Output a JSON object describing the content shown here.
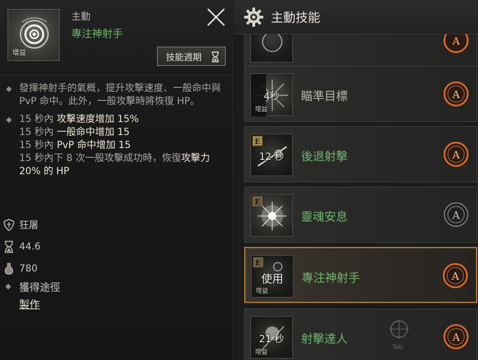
{
  "tooltip": {
    "skill_type": "主動",
    "skill_name": "專注神射手",
    "icon_tag": "增益",
    "cycle_button_label": "技能週期",
    "description": "發揮神射手的氣概，提升攻擊速度、一般命中與 PvP 命中。此外，一般攻擊時將恢復 HP。",
    "effects": {
      "line1_prefix": "15 秒內 ",
      "line1_hl": "攻擊速度增加 15%",
      "line2_prefix": "15 秒內 ",
      "line2_hl": "一般命中增加 15",
      "line3_prefix": "15 秒內 ",
      "line3_hl": " PvP 命中增加 15",
      "line4_prefix": "15 秒內下 8 次一般攻擊成功時，恢復",
      "line4_hl": "攻擊力 20% 的 HP"
    },
    "stats": [
      {
        "icon": "shield-icon",
        "value": "狂屠"
      },
      {
        "icon": "hourglass-icon",
        "value": "44.6"
      },
      {
        "icon": "potion-icon",
        "value": "780"
      }
    ],
    "acquire_title": "獲得途徑",
    "acquire_link": "製作"
  },
  "skill_list": {
    "title": "主動技能",
    "items": [
      {
        "name": "瞄準目標",
        "cooldown": "4秒",
        "tag": "增益",
        "badge": "",
        "auto": "A"
      },
      {
        "name": "後退射擊",
        "cooldown": "12 秒",
        "tag": "",
        "badge": "E",
        "auto": "A"
      },
      {
        "name": "靈魂安息",
        "cooldown": "",
        "tag": "",
        "badge": "E",
        "auto": "A"
      },
      {
        "name": "專注神射手",
        "use_label": "使用",
        "tag": "增益",
        "badge": "E",
        "auto": "A"
      },
      {
        "name": "射擊達人",
        "cooldown": "21 秒",
        "tag": "增益",
        "badge": "",
        "auto": "A"
      }
    ],
    "tab_hint": "Tab"
  },
  "colors": {
    "accent_orange": "#e06a2a",
    "skill_green": "#6fb46d",
    "selected_border": "#a57338"
  }
}
